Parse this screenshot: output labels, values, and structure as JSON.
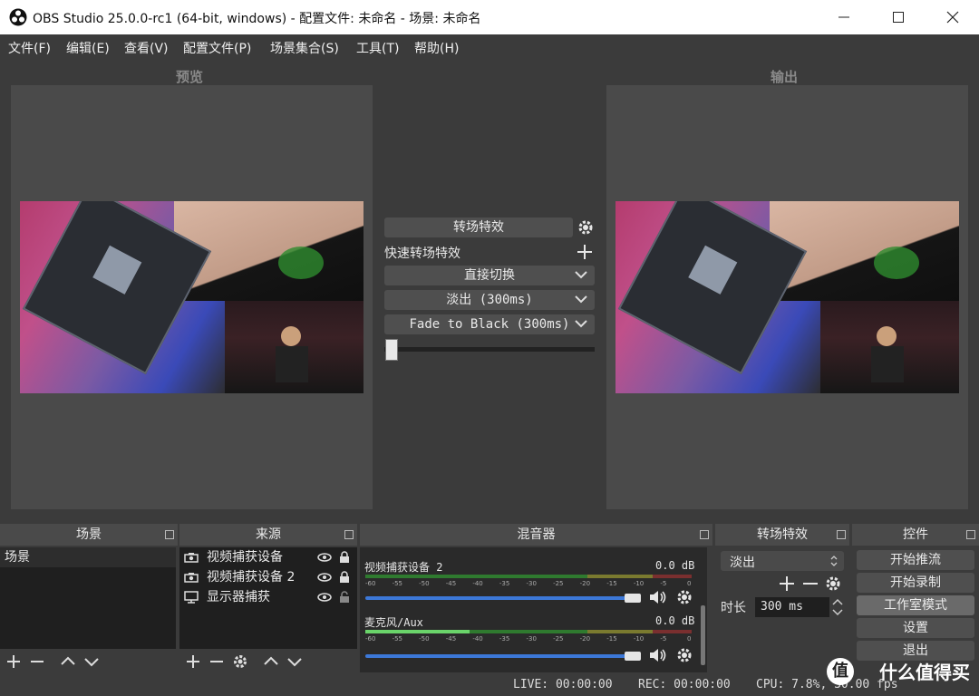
{
  "window": {
    "title": "OBS Studio 25.0.0-rc1 (64-bit, windows) - 配置文件: 未命名 - 场景: 未命名"
  },
  "menu": [
    "文件(F)",
    "编辑(E)",
    "查看(V)",
    "配置文件(P)",
    "场景集合(S)",
    "工具(T)",
    "帮助(H)"
  ],
  "preview": {
    "label": "预览"
  },
  "output": {
    "label": "输出"
  },
  "transition_panel": {
    "transition_button": "转场特效",
    "quick_label": "快速转场特效",
    "items": [
      "直接切换",
      "淡出 (300ms)",
      "Fade to Black (300ms)"
    ],
    "slider_value": 0
  },
  "scenes": {
    "header": "场景",
    "items": [
      "场景"
    ]
  },
  "sources": {
    "header": "来源",
    "items": [
      {
        "name": "视频捕获设备",
        "icon": "camera-icon",
        "visible": true,
        "locked": true
      },
      {
        "name": "视频捕获设备 2",
        "icon": "camera-icon",
        "visible": true,
        "locked": true
      },
      {
        "name": "显示器捕获",
        "icon": "monitor-icon",
        "visible": true,
        "locked": false
      }
    ]
  },
  "mixer": {
    "header": "混音器",
    "channels": [
      {
        "name": "视频捕获设备 2",
        "db": "0.0 dB",
        "volume": 0.97
      },
      {
        "name": "麦克风/Aux",
        "db": "0.0 dB",
        "volume": 0.97
      }
    ],
    "scale": [
      "-60",
      "-55",
      "-50",
      "-45",
      "-40",
      "-35",
      "-30",
      "-25",
      "-20",
      "-15",
      "-10",
      "-5",
      "0"
    ]
  },
  "transitions": {
    "header": "转场特效",
    "selected": "淡出",
    "duration_label": "时长",
    "duration_value": "300 ms"
  },
  "controls": {
    "header": "控件",
    "buttons": [
      "开始推流",
      "开始录制",
      "工作室模式",
      "设置",
      "退出"
    ]
  },
  "status": {
    "live": "LIVE: 00:00:00",
    "rec": "REC: 00:00:00",
    "cpu": "CPU: 7.8%, 30.00 fps"
  },
  "watermark": {
    "glyph": "值",
    "text": "什么值得买"
  },
  "colors": {
    "accent": "#3c78d8",
    "panel": "#3b3b3b",
    "dark": "#1f1f1f"
  }
}
